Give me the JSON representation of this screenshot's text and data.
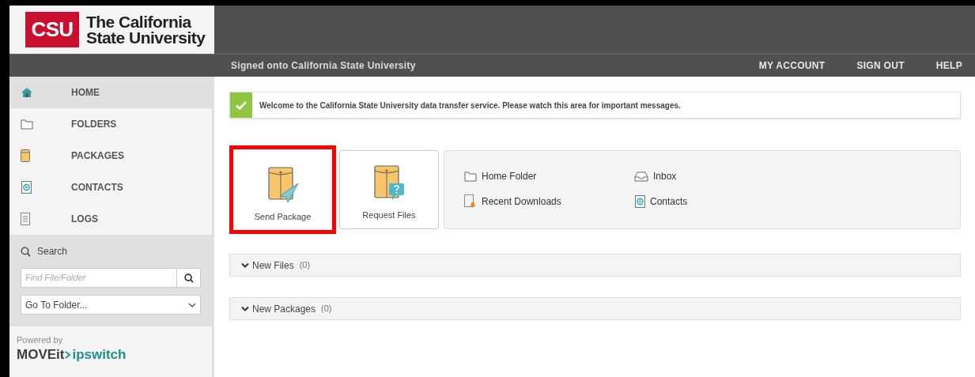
{
  "header": {
    "logo_mark": "CSU",
    "logo_lines": [
      "The California",
      "State University"
    ]
  },
  "nav_bar": {
    "signed_on": "Signed onto **California State University**",
    "links": [
      "MY ACCOUNT",
      "SIGN OUT",
      "HELP"
    ]
  },
  "sidebar": {
    "items": [
      {
        "label": "HOME",
        "kind": "home",
        "selected": true
      },
      {
        "label": "FOLDERS",
        "kind": "folder",
        "selected": false
      },
      {
        "label": "PACKAGES",
        "kind": "package",
        "selected": false
      },
      {
        "label": "CONTACTS",
        "kind": "contacts",
        "selected": false
      },
      {
        "label": "LOGS",
        "kind": "logs",
        "selected": false
      }
    ],
    "search": {
      "title": "Search",
      "placeholder": "Find File/Folder",
      "folder_select": "Go To Folder..."
    },
    "powered_by": {
      "label": "Powered by",
      "brand": "MOVEit",
      "vendor": "ipswitch"
    }
  },
  "message": "Welcome to the California State University data transfer service. Please watch this area for important messages.",
  "actions": [
    {
      "label": "Send Package",
      "kind": "send",
      "highlighted": true
    },
    {
      "label": "Request Files",
      "kind": "request",
      "highlighted": false
    }
  ],
  "quick_links": [
    {
      "label": "Home Folder",
      "kind": "folder"
    },
    {
      "label": "Inbox",
      "kind": "inbox"
    },
    {
      "label": "Recent Downloads",
      "kind": "downloads"
    },
    {
      "label": "Contacts",
      "kind": "contacts"
    }
  ],
  "sections": [
    {
      "title": "New Files",
      "count": "(0)",
      "expanded": true
    },
    {
      "title": "New Packages",
      "count": "(0)",
      "expanded": true
    }
  ]
}
